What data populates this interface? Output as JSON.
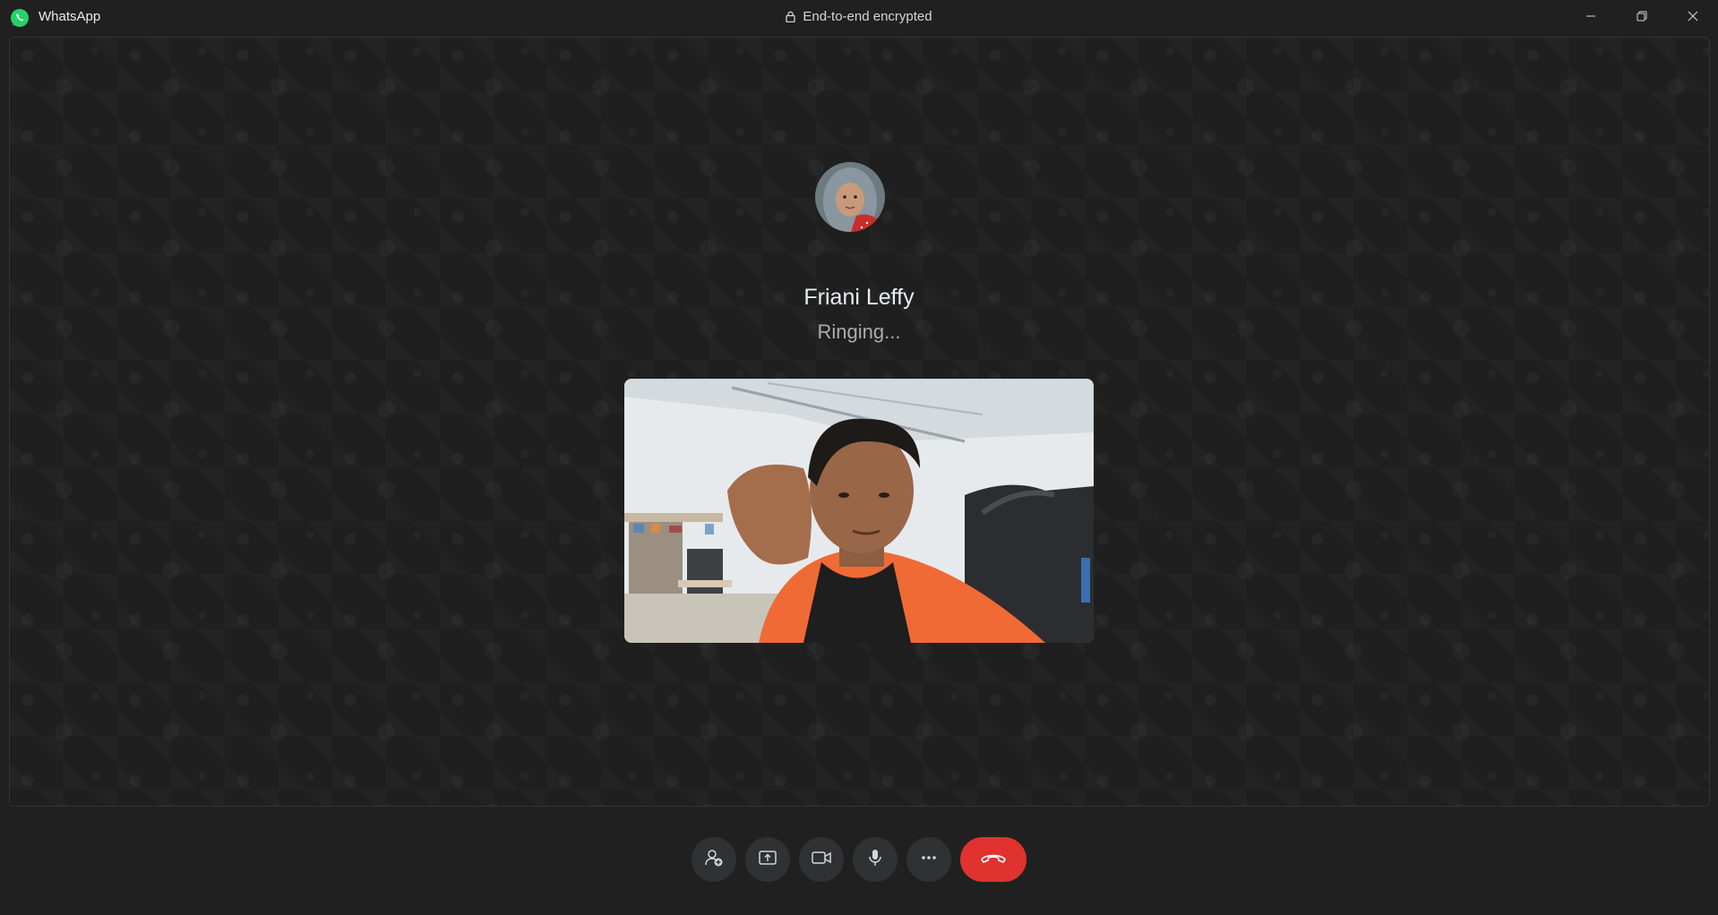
{
  "app": {
    "name": "WhatsApp",
    "logo_icon": "whatsapp-logo-icon",
    "brand_color": "#25d366"
  },
  "titlebar": {
    "encryption_label": "End-to-end encrypted",
    "encryption_icon": "lock-icon",
    "controls": [
      {
        "name": "minimize",
        "icon": "minimize-icon"
      },
      {
        "name": "restore",
        "icon": "restore-icon"
      },
      {
        "name": "close",
        "icon": "close-icon"
      }
    ]
  },
  "call": {
    "contact_name": "Friani Leffy",
    "status": "Ringing...",
    "avatar_icon": "contact-avatar",
    "self_video": "self-camera-preview"
  },
  "controls": [
    {
      "name": "add-participant",
      "icon": "add-person-icon"
    },
    {
      "name": "share-screen",
      "icon": "share-screen-icon"
    },
    {
      "name": "video-toggle",
      "icon": "video-camera-icon"
    },
    {
      "name": "mic-toggle",
      "icon": "microphone-icon"
    },
    {
      "name": "more-options",
      "icon": "more-dots-icon"
    },
    {
      "name": "end-call",
      "icon": "hang-up-icon"
    }
  ],
  "colors": {
    "background": "#202020",
    "button_bg": "#2f3133",
    "end_call": "#e0322f"
  }
}
